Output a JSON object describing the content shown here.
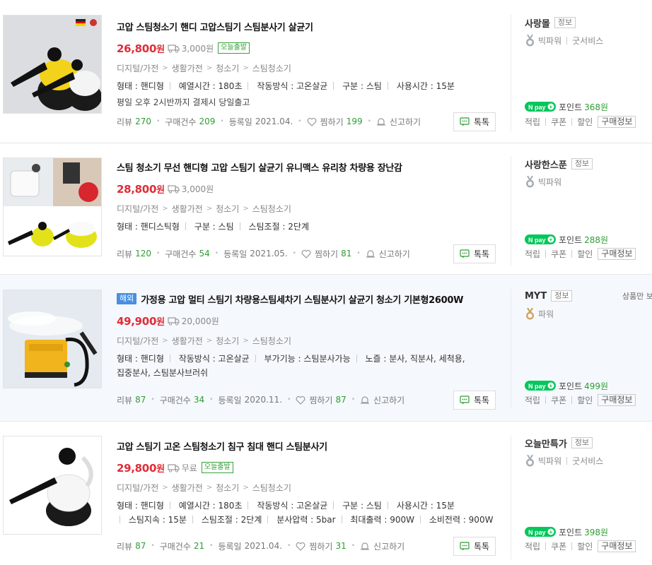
{
  "items": [
    {
      "id": "item1",
      "title": "고압 스팀청소기 핸디 고압스팀기 스팀분사기 살균기",
      "overseas": "",
      "price": "26,800",
      "won": "원",
      "shipping": "3,000원",
      "today_badge": "오늘출발",
      "category": [
        "디지털/가전",
        "생활가전",
        "청소기",
        "스팀청소기"
      ],
      "specs": [
        "형태 : 핸디형",
        "예열시간 : 180초",
        "작동방식 : 고온살균",
        "구분 : 스팀",
        "사용시간 : 15분"
      ],
      "desc": "평일 오후 2시반까지 결제시 당일출고",
      "review_label": "리뷰",
      "review_count": "270",
      "purchase_label": "구매건수",
      "purchase_count": "209",
      "reg_label": "등록일",
      "reg_date": "2021.04.",
      "like_label": "찜하기",
      "like_count": "199",
      "report_label": "신고하기",
      "talk_label": "톡톡",
      "seller": "사랑몰",
      "info_label": "정보",
      "grade": "빅파워",
      "service": "굿서비스",
      "npay_plus": "N pay +",
      "point_label": "포인트",
      "point": "368원",
      "links": [
        "적립",
        "쿠폰",
        "할인"
      ],
      "buy_info": "구매정보"
    },
    {
      "id": "item2",
      "title": "스팀 청소기 무선 핸디형 고압 스팀기 살균기 유니맥스 유리창 차량용 장난감",
      "overseas": "",
      "price": "28,800",
      "won": "원",
      "shipping": "3,000원",
      "today_badge": "",
      "category": [
        "디지털/가전",
        "생활가전",
        "청소기",
        "스팀청소기"
      ],
      "specs": [
        "형태 : 핸디스틱형",
        "구분 : 스팀",
        "스팀조절 : 2단계"
      ],
      "desc": "",
      "review_label": "리뷰",
      "review_count": "120",
      "purchase_label": "구매건수",
      "purchase_count": "54",
      "reg_label": "등록일",
      "reg_date": "2021.05.",
      "like_label": "찜하기",
      "like_count": "81",
      "report_label": "신고하기",
      "talk_label": "톡톡",
      "seller": "사랑한스푼",
      "info_label": "정보",
      "grade": "빅파워",
      "service": "",
      "npay_plus": "N pay +",
      "point_label": "포인트",
      "point": "288원",
      "links": [
        "적립",
        "쿠폰",
        "할인"
      ],
      "buy_info": "구매정보"
    },
    {
      "id": "item3",
      "title": "가정용 고압 멀티 스팀기 차량용스팀세차기 스팀분사기 살균기 청소기 기본형2600W",
      "overseas": "해외",
      "price": "49,900",
      "won": "원",
      "shipping": "20,000원",
      "today_badge": "",
      "category": [
        "디지털/가전",
        "생활가전",
        "청소기",
        "스팀청소기"
      ],
      "specs": [
        "형태 : 핸디형",
        "작동방식 : 고온살균",
        "부가기능 : 스팀분사가능",
        "노즐 : 분사, 직분사, 세척용,",
        "집중분사, 스팀분사브러쉬"
      ],
      "desc": "",
      "review_label": "리뷰",
      "review_count": "87",
      "purchase_label": "구매건수",
      "purchase_count": "34",
      "reg_label": "등록일",
      "reg_date": "2020.11.",
      "like_label": "찜하기",
      "like_count": "87",
      "report_label": "신고하기",
      "talk_label": "톡톡",
      "seller": "MYT",
      "info_label": "정보",
      "grade": "파워",
      "service": "",
      "npay_plus": "N pay +",
      "point_label": "포인트",
      "point": "499원",
      "links": [
        "적립",
        "쿠폰",
        "할인"
      ],
      "buy_info": "구매정보",
      "side_note": "상품만 보"
    },
    {
      "id": "item4",
      "title": "고압 스팀기 고온 스팀청소기 침구 침대 핸디 스팀분사기",
      "overseas": "",
      "price": "29,800",
      "won": "원",
      "shipping": "무료",
      "today_badge": "오늘출발",
      "category": [
        "디지털/가전",
        "생활가전",
        "청소기",
        "스팀청소기"
      ],
      "specs": [
        "형태 : 핸디형",
        "예열시간 : 180초",
        "작동방식 : 고온살균",
        "구분 : 스팀",
        "사용시간 : 15분",
        "스팀지속 : 15분",
        "스팀조절 : 2단계",
        "분사압력 : 5bar",
        "최대출력 : 900W",
        "소비전력 : 900W"
      ],
      "desc": "",
      "review_label": "리뷰",
      "review_count": "87",
      "purchase_label": "구매건수",
      "purchase_count": "21",
      "reg_label": "등록일",
      "reg_date": "2021.04.",
      "like_label": "찜하기",
      "like_count": "31",
      "report_label": "신고하기",
      "talk_label": "톡톡",
      "seller": "오늘만특가",
      "info_label": "정보",
      "grade": "빅파워",
      "service": "굿서비스",
      "npay_plus": "N pay +",
      "point_label": "포인트",
      "point": "398원",
      "links": [
        "적립",
        "쿠폰",
        "할인"
      ],
      "buy_info": "구매정보"
    }
  ],
  "colors": {
    "price": "#e02c37",
    "count": "#2f9d33",
    "npay": "#03c75a",
    "overseas": "#4a8fe1"
  },
  "icons": [
    "truck-icon",
    "heart-icon",
    "bell-icon",
    "talk-icon",
    "medal-icon",
    "npay-logo"
  ]
}
